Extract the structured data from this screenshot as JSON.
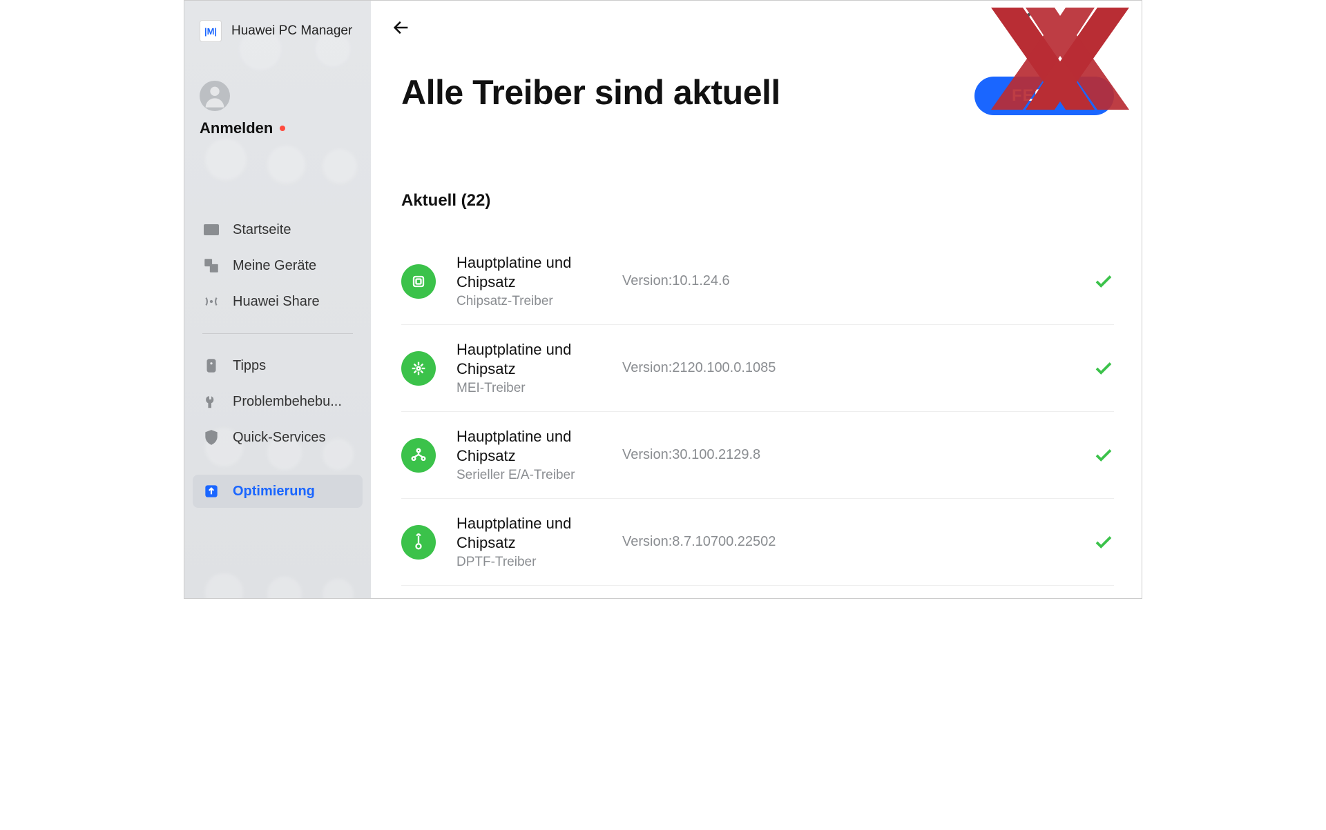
{
  "app": {
    "name": "Huawei PC Manager",
    "logo_text": "|M|"
  },
  "account": {
    "signin_label": "Anmelden"
  },
  "sidebar": {
    "items": [
      {
        "label": "Startseite",
        "icon": "home"
      },
      {
        "label": "Meine Geräte",
        "icon": "devices"
      },
      {
        "label": "Huawei Share",
        "icon": "share"
      },
      {
        "label": "Tipps",
        "icon": "tip"
      },
      {
        "label": "Problembehebu...",
        "icon": "wrench"
      },
      {
        "label": "Quick-Services",
        "icon": "shield"
      },
      {
        "label": "Optimierung",
        "icon": "optimize",
        "active": true
      }
    ]
  },
  "main": {
    "page_title": "Alle Treiber sind aktuell",
    "done_button": "FERTIG",
    "section_heading": "Aktuell (22)",
    "version_prefix": "Version:",
    "drivers": [
      {
        "category": "Hauptplatine und Chipsatz",
        "sub": "Chipsatz-Treiber",
        "version": "10.1.24.6",
        "icon": "chip"
      },
      {
        "category": "Hauptplatine und Chipsatz",
        "sub": "MEI-Treiber",
        "version": "2120.100.0.1085",
        "icon": "mei"
      },
      {
        "category": "Hauptplatine und Chipsatz",
        "sub": "Serieller E/A-Treiber",
        "version": "30.100.2129.8",
        "icon": "serial"
      },
      {
        "category": "Hauptplatine und Chipsatz",
        "sub": "DPTF-Treiber",
        "version": "8.7.10700.22502",
        "icon": "thermal"
      }
    ]
  }
}
